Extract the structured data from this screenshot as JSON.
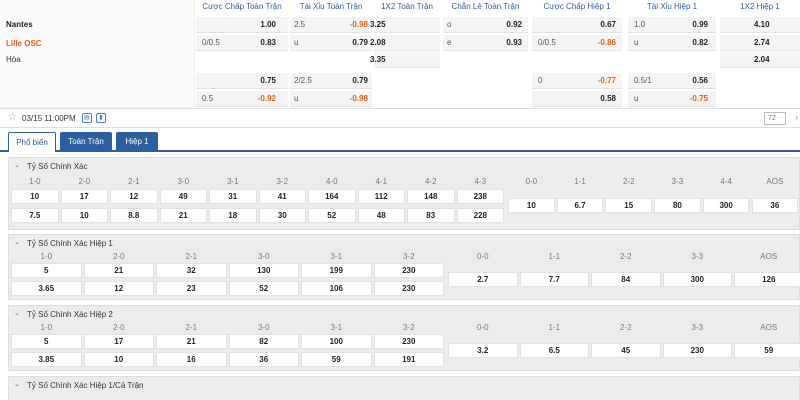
{
  "teams": {
    "home": "Nantes",
    "away": "Lille OSC",
    "draw": "Hòa"
  },
  "odds_headers": [
    "Cược Chấp Toàn Trận",
    "Tài Xỉu Toàn Trận",
    "1X2 Toàn Trận",
    "Chẵn Lẻ Toàn Trận",
    "Cược Chấp Hiệp 1",
    "Tài Xỉu Hiệp 1",
    "1X2 Hiệp 1"
  ],
  "odds": {
    "r1": {
      "hc_val": "1.00",
      "ou_line": "2.5",
      "ou_val": "-0.98",
      "x12": "3.25",
      "oe_lbl": "o",
      "oe_val": "0.92",
      "hc1_val": "0.67",
      "ou1_line": "1.0",
      "ou1_val": "0.99",
      "x12_1": "4.10"
    },
    "r2": {
      "hc_line": "0/0.5",
      "hc_val": "0.83",
      "ou_lbl": "u",
      "ou_val": "0.79",
      "x12": "2.08",
      "oe_lbl": "e",
      "oe_val": "0.93",
      "hc1_line": "0/0.5",
      "hc1_val": "-0.86",
      "ou1_lbl": "u",
      "ou1_val": "0.82",
      "x12_1": "2.74"
    },
    "r3": {
      "x12": "3.35",
      "x12_1": "2.04"
    },
    "r4": {
      "hc_val": "0.75",
      "ou_line": "2/2.5",
      "ou_val": "0.79",
      "hc1_line": "0",
      "hc1_val": "-0.77",
      "ou1_line": "0.5/1",
      "ou1_val": "0.56"
    },
    "r5": {
      "hc_line": "0.5",
      "hc_val": "-0.92",
      "ou_lbl": "u",
      "ou_val": "-0.98",
      "hc1_val": "0.58",
      "ou1_lbl": "u",
      "ou1_val": "-0.75"
    }
  },
  "matchbar": {
    "date": "03/15 11:00PM",
    "counter": "72",
    "star_icon": "star-icon",
    "calendar_icon": "calendar-icon",
    "chart_icon": "bar-chart-icon"
  },
  "tabs": [
    "Phổ biến",
    "Toàn Trận",
    "Hiệp 1"
  ],
  "sections": {
    "s1": {
      "title": "Tỷ Số Chính Xác",
      "labels": [
        "1-0",
        "2-0",
        "2-1",
        "3-0",
        "3-1",
        "3-2",
        "4-0",
        "4-1",
        "4-2",
        "4-3",
        "0-0",
        "1-1",
        "2-2",
        "3-3",
        "4-4",
        "AOS"
      ],
      "row1": [
        "10",
        "17",
        "12",
        "49",
        "31",
        "41",
        "164",
        "112",
        "148",
        "238"
      ],
      "row2": [
        "7.5",
        "10",
        "8.8",
        "21",
        "18",
        "30",
        "52",
        "48",
        "83",
        "228"
      ],
      "draws": [
        "10",
        "6.7",
        "15",
        "80",
        "300",
        "36"
      ]
    },
    "s2": {
      "title": "Tỷ Số Chính Xác Hiệp 1",
      "labels": [
        "1-0",
        "2-0",
        "2-1",
        "3-0",
        "3-1",
        "3-2",
        "0-0",
        "1-1",
        "2-2",
        "3-3",
        "AOS"
      ],
      "row1": [
        "5",
        "21",
        "32",
        "130",
        "199",
        "230"
      ],
      "row2": [
        "3.65",
        "12",
        "23",
        "52",
        "106",
        "230"
      ],
      "draws": [
        "2.7",
        "7.7",
        "84",
        "300",
        "126"
      ]
    },
    "s3": {
      "title": "Tỷ Số Chính Xác Hiệp 2",
      "labels": [
        "1-0",
        "2-0",
        "2-1",
        "3-0",
        "3-1",
        "3-2",
        "0-0",
        "1-1",
        "2-2",
        "3-3",
        "AOS"
      ],
      "row1": [
        "5",
        "17",
        "21",
        "82",
        "100",
        "230"
      ],
      "row2": [
        "3.85",
        "10",
        "16",
        "36",
        "59",
        "191"
      ],
      "draws": [
        "3.2",
        "6.5",
        "45",
        "230",
        "59"
      ]
    },
    "s4": {
      "title": "Tỷ Số Chính Xác Hiệp 1/Cả Trận"
    }
  }
}
